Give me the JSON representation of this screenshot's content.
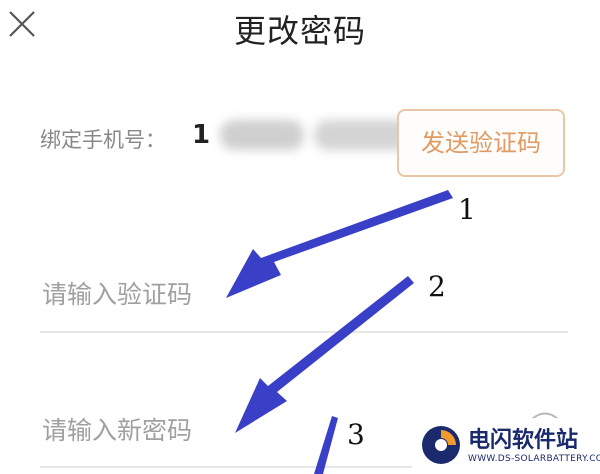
{
  "header": {
    "title": "更改密码"
  },
  "form": {
    "phone_label": "绑定手机号：",
    "phone_value_visible": "1",
    "send_code_button": "发送验证码",
    "code_placeholder": "请输入验证码",
    "password_placeholder": "请输入新密码"
  },
  "annotations": {
    "steps": [
      "1",
      "2",
      "3"
    ],
    "arrow_color": "#3a3fc8"
  },
  "watermark": {
    "title": "电闪软件站",
    "subtitle": "WWW.DS-SOLARBATTERY.COM"
  },
  "colors": {
    "accent": "#e09a62",
    "accent_border": "#e8c6a6",
    "placeholder": "#a0a0a0",
    "divider": "#e6e6e6"
  },
  "icons": {
    "close": "close-icon",
    "eye": "eye-icon"
  }
}
